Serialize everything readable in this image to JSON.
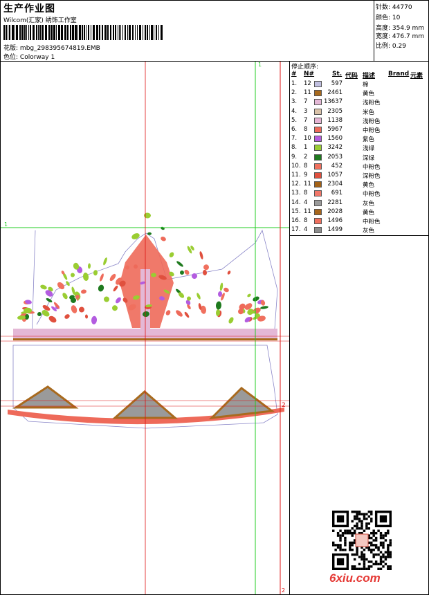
{
  "header": {
    "title": "生产作业图",
    "subtitle": "Wilcom(汇家) 绣饰工作室",
    "design_label": "花版:",
    "design_value": "mbg_298395674819.EMB",
    "colorway_label": "色位:",
    "colorway_value": "Colorway 1"
  },
  "stats": [
    {
      "label": "针数:",
      "value": "44770"
    },
    {
      "label": "颜色:",
      "value": "10"
    },
    {
      "label": "高度:",
      "value": "354.9 mm"
    },
    {
      "label": "宽度:",
      "value": "476.7 mm"
    },
    {
      "label": "比例:",
      "value": "0.29"
    }
  ],
  "stop_sequence": {
    "title": "停止顺序:",
    "columns": {
      "num": "#",
      "n": "N#",
      "st": "St.",
      "code": "代码",
      "desc": "描述",
      "brand": "Brand",
      "element": "元素"
    },
    "rows": [
      {
        "num": "1.",
        "n": "12",
        "code": "597",
        "desc": "棉",
        "color": "#c0bfe0"
      },
      {
        "num": "2.",
        "n": "11",
        "code": "2461",
        "desc": "黄色",
        "color": "#a86a1e"
      },
      {
        "num": "3.",
        "n": "7",
        "code": "13637",
        "desc": "浅粉色",
        "color": "#e4b8d6"
      },
      {
        "num": "4.",
        "n": "3",
        "code": "2305",
        "desc": "米色",
        "color": "#d9c2a8"
      },
      {
        "num": "5.",
        "n": "7",
        "code": "1138",
        "desc": "浅粉色",
        "color": "#e6b4d4"
      },
      {
        "num": "6.",
        "n": "8",
        "code": "5967",
        "desc": "中粉色",
        "color": "#ee6a5a"
      },
      {
        "num": "7.",
        "n": "10",
        "code": "1560",
        "desc": "紫色",
        "color": "#b35ce0"
      },
      {
        "num": "8.",
        "n": "1",
        "code": "3242",
        "desc": "浅绿",
        "color": "#9acd32"
      },
      {
        "num": "9.",
        "n": "2",
        "code": "2053",
        "desc": "深绿",
        "color": "#1e7a1e"
      },
      {
        "num": "10.",
        "n": "8",
        "code": "452",
        "desc": "中粉色",
        "color": "#f0705e"
      },
      {
        "num": "11.",
        "n": "9",
        "code": "1057",
        "desc": "深粉色",
        "color": "#e0503e"
      },
      {
        "num": "12.",
        "n": "11",
        "code": "2304",
        "desc": "黄色",
        "color": "#a46216"
      },
      {
        "num": "13.",
        "n": "8",
        "code": "691",
        "desc": "中粉色",
        "color": "#f2786a"
      },
      {
        "num": "14.",
        "n": "4",
        "code": "2281",
        "desc": "灰色",
        "color": "#9a9a9a"
      },
      {
        "num": "15.",
        "n": "11",
        "code": "2028",
        "desc": "黄色",
        "color": "#a7661c"
      },
      {
        "num": "16.",
        "n": "8",
        "code": "1496",
        "desc": "中粉色",
        "color": "#ef705e"
      },
      {
        "num": "17.",
        "n": "4",
        "code": "1499",
        "desc": "灰色",
        "color": "#8e8e8e"
      }
    ]
  },
  "guides": {
    "label_1": "1",
    "label_2": "2"
  },
  "watermark": {
    "text": "6xiu.com"
  },
  "colors": {
    "guide_green": "#22cc22",
    "guide_red": "#dd1111",
    "outline": "#8a86c8"
  }
}
